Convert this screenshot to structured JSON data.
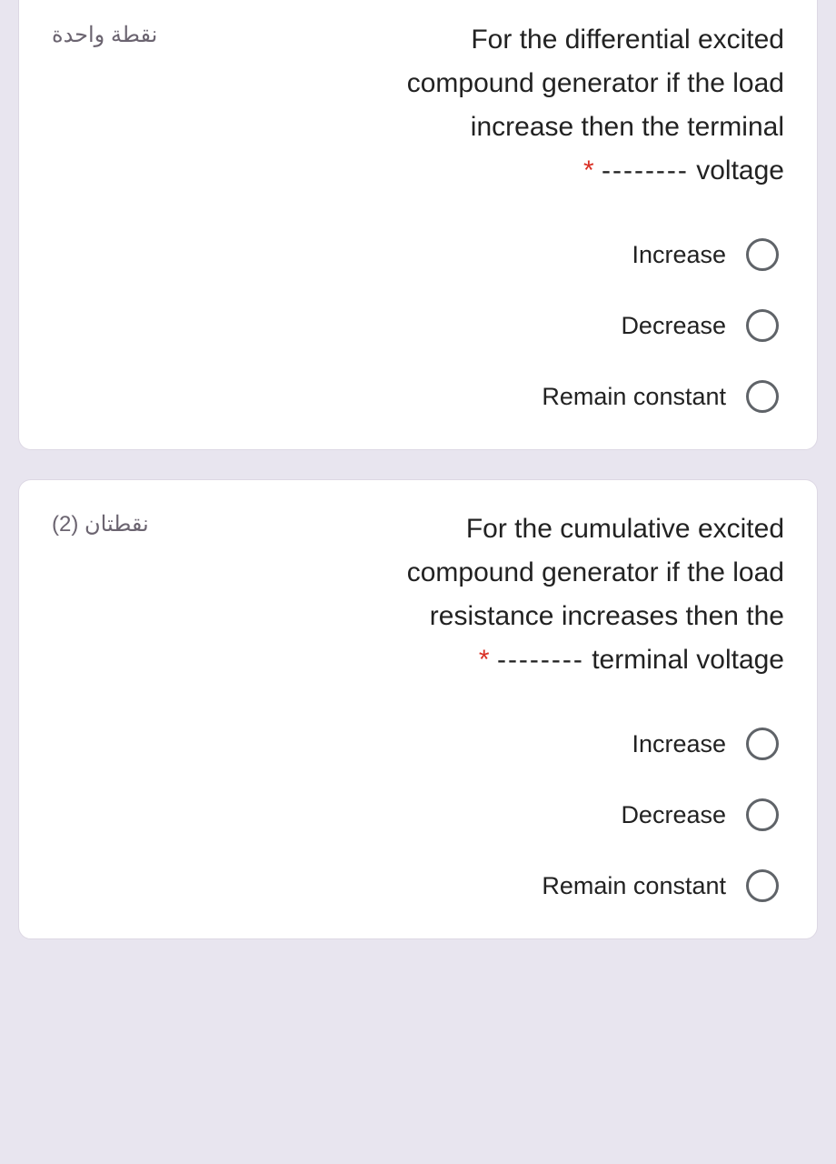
{
  "questions": [
    {
      "points": "نقطة واحدة",
      "text_line1": "For the differential excited",
      "text_line2": "compound generator if the load",
      "text_line3": "increase then the terminal",
      "text_line4_end": "voltage",
      "blank": "--------",
      "required": "*",
      "options": [
        {
          "label": "Increase"
        },
        {
          "label": "Decrease"
        },
        {
          "label": "Remain constant"
        }
      ]
    },
    {
      "points": "نقطتان (2)",
      "text_line1": "For the cumulative excited",
      "text_line2": "compound generator if the load",
      "text_line3": "resistance increases then the",
      "text_line4_end": "terminal voltage",
      "blank": "--------",
      "required": "*",
      "options": [
        {
          "label": "Increase"
        },
        {
          "label": "Decrease"
        },
        {
          "label": "Remain constant"
        }
      ]
    }
  ]
}
